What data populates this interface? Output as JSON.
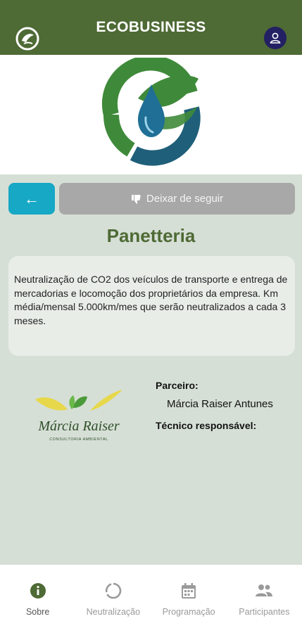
{
  "header": {
    "title": "ECOBUSINESS",
    "logo_icon": "eco-leaf-logo-icon",
    "profile_icon": "user-icon",
    "bar_color": "#4e6a35"
  },
  "hero": {
    "logo_icon": "water-drop-leaf-logo"
  },
  "actions": {
    "back_label": "←",
    "unfollow_label": "Deixar de seguir",
    "unfollow_icon": "thumbs-down-icon"
  },
  "company": {
    "name": "Panetteria",
    "description": "Neutralização de CO2 dos veículos de transporte e entrega de mercadorias e locomoção dos proprietários da empresa. Km média/mensal 5.000km/mes que serão neutralizados a cada 3 meses."
  },
  "partner": {
    "label": "Parceiro:",
    "name": "Márcia Raiser Antunes",
    "tech_label": "Técnico responsável:",
    "logo_text": "Márcia Raiser",
    "logo_subtext": "CONSULTORIA AMBIENTAL"
  },
  "nav": {
    "items": [
      {
        "label": "Sobre",
        "icon": "info-icon",
        "active": true
      },
      {
        "label": "Neutralização",
        "icon": "circle-progress-icon",
        "active": false
      },
      {
        "label": "Programação",
        "icon": "calendar-icon",
        "active": false
      },
      {
        "label": "Participantes",
        "icon": "people-icon",
        "active": false
      }
    ]
  }
}
